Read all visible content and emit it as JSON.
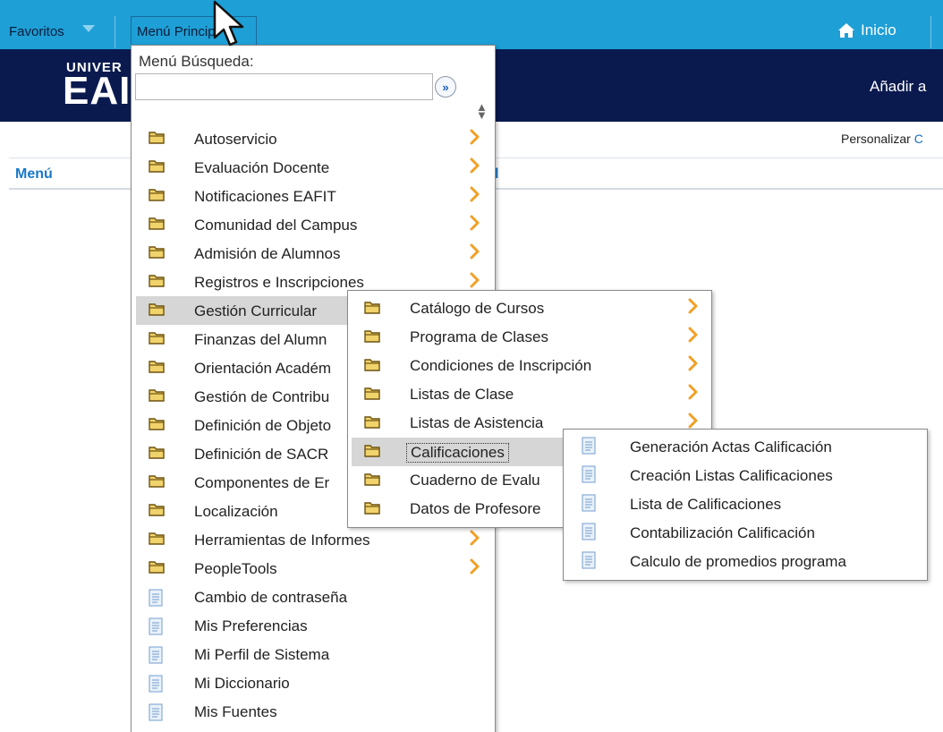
{
  "topbar": {
    "favoritos": "Favoritos",
    "menu_principal": "Menú Principal",
    "inicio": "Inicio",
    "colors": {
      "bar": "#1e9fd6",
      "banner": "#0a1a4f"
    }
  },
  "banner": {
    "logo_line1": "UNIVER",
    "logo_line2": "EAI",
    "anadir": "Añadir a"
  },
  "page": {
    "personalizar": "Personalizar",
    "personalizar_link": "C",
    "menu_heading": "Menú",
    "heading_trail": "l"
  },
  "menu_search": {
    "label": "Menú Búsqueda:",
    "value": "",
    "go_icon": "double-chevron-right-icon"
  },
  "menu_items": [
    {
      "label": "Autoservicio",
      "type": "folder",
      "submenu": true
    },
    {
      "label": "Evaluación Docente",
      "type": "folder",
      "submenu": true
    },
    {
      "label": "Notificaciones EAFIT",
      "type": "folder",
      "submenu": true
    },
    {
      "label": "Comunidad del Campus",
      "type": "folder",
      "submenu": true
    },
    {
      "label": "Admisión de Alumnos",
      "type": "folder",
      "submenu": true
    },
    {
      "label": "Registros e Inscripciones",
      "type": "folder",
      "submenu": true
    },
    {
      "label": "Gestión Curricular",
      "type": "folder",
      "submenu": true,
      "active": true
    },
    {
      "label": "Finanzas del Alumn",
      "type": "folder",
      "submenu": true
    },
    {
      "label": "Orientación Académ",
      "type": "folder",
      "submenu": true
    },
    {
      "label": "Gestión de Contribu",
      "type": "folder",
      "submenu": true
    },
    {
      "label": "Definición de Objeto",
      "type": "folder",
      "submenu": true
    },
    {
      "label": "Definición de SACR",
      "type": "folder",
      "submenu": true
    },
    {
      "label": "Componentes de Er",
      "type": "folder",
      "submenu": true
    },
    {
      "label": "Localización",
      "type": "folder",
      "submenu": true
    },
    {
      "label": "Herramientas de Informes",
      "type": "folder",
      "submenu": true
    },
    {
      "label": "PeopleTools",
      "type": "folder",
      "submenu": true
    },
    {
      "label": "Cambio de contraseña",
      "type": "page",
      "submenu": false
    },
    {
      "label": "Mis Preferencias",
      "type": "page",
      "submenu": false
    },
    {
      "label": "Mi Perfil de Sistema",
      "type": "page",
      "submenu": false
    },
    {
      "label": "Mi Diccionario",
      "type": "page",
      "submenu": false
    },
    {
      "label": "Mis Fuentes",
      "type": "page",
      "submenu": false
    }
  ],
  "submenu_items": [
    {
      "label": "Catálogo de Cursos",
      "submenu": true
    },
    {
      "label": "Programa de Clases",
      "submenu": true
    },
    {
      "label": "Condiciones de Inscripción",
      "submenu": true
    },
    {
      "label": "Listas de Clase",
      "submenu": true
    },
    {
      "label": "Listas de Asistencia",
      "submenu": true
    },
    {
      "label": "Calificaciones",
      "submenu": true,
      "active": true
    },
    {
      "label": "Cuaderno de Evalu",
      "submenu": true
    },
    {
      "label": "Datos de Profesore",
      "submenu": true
    }
  ],
  "submenu2_items": [
    {
      "label": "Generación Actas Calificación"
    },
    {
      "label": "Creación Listas Calificaciones"
    },
    {
      "label": "Lista de Calificaciones"
    },
    {
      "label": "Contabilización Calificación"
    },
    {
      "label": "Calculo de promedios programa"
    }
  ]
}
